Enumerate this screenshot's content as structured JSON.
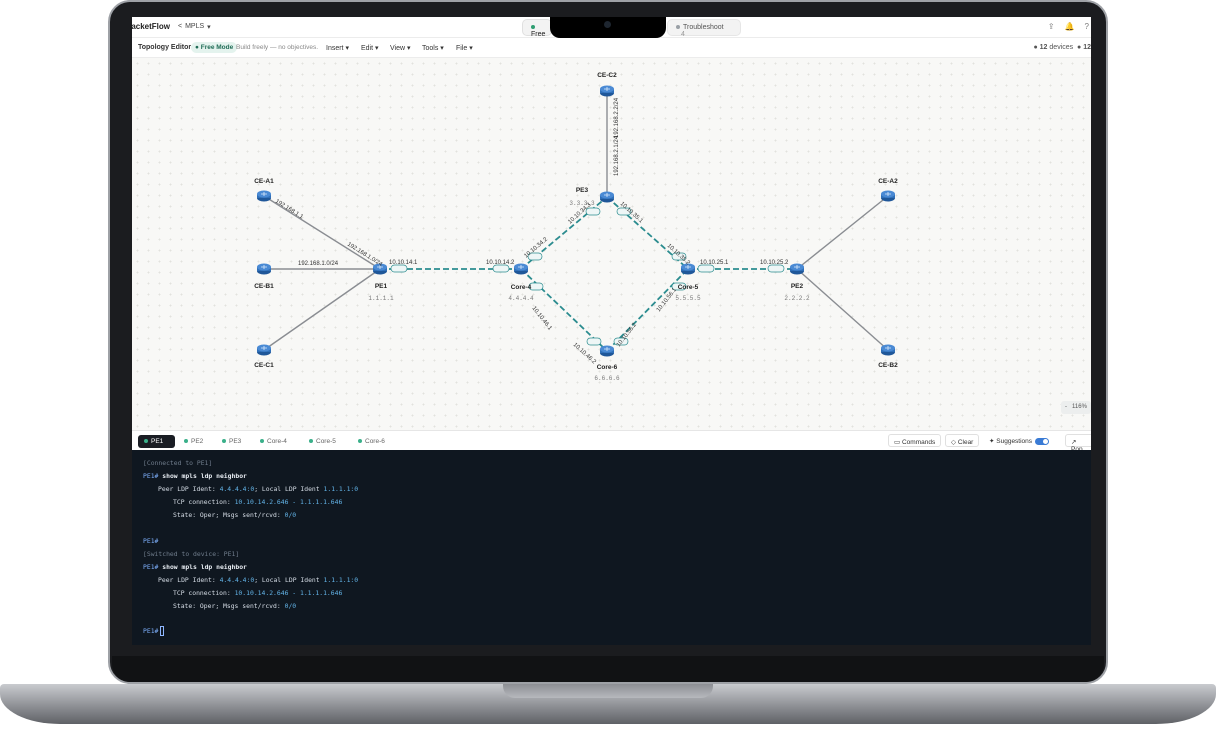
{
  "app": {
    "brand": "PacketFlow",
    "project": "MPLS"
  },
  "tabs": [
    {
      "label": "Free",
      "status_color": "#2f9e72"
    },
    {
      "label": "Troubleshoot",
      "count": "4"
    }
  ],
  "editor": {
    "title": "Topology Editor",
    "mode_badge": "Free Mode",
    "subtitle": "Build freely — no objectives.",
    "menus": [
      "Insert",
      "Edit",
      "View",
      "Tools",
      "File"
    ],
    "device_count": "12",
    "device_count_label": "devices",
    "extra_count": "12"
  },
  "topology": {
    "nodes": [
      {
        "id": "CE-C2",
        "loopback": ""
      },
      {
        "id": "PE3",
        "loopback": "3.3.3.3"
      },
      {
        "id": "CE-A1",
        "loopback": ""
      },
      {
        "id": "CE-B1",
        "loopback": ""
      },
      {
        "id": "CE-C1",
        "loopback": ""
      },
      {
        "id": "PE1",
        "loopback": "1.1.1.1"
      },
      {
        "id": "Core-4",
        "loopback": "4.4.4.4"
      },
      {
        "id": "Core-5",
        "loopback": "5.5.5.5"
      },
      {
        "id": "Core-6",
        "loopback": "6.6.6.6"
      },
      {
        "id": "PE2",
        "loopback": "2.2.2.2"
      },
      {
        "id": "CE-A2",
        "loopback": ""
      },
      {
        "id": "CE-B2",
        "loopback": ""
      }
    ],
    "link_labels": {
      "pe3_cec2": "192.168.2.1/24",
      "cec2_pe3": "192.168.2.2/24",
      "pe3_core4": "10.10.34.3",
      "core4_pe3": "10.10.34.2",
      "pe3_core5": "10.10.35.1",
      "core5_pe3": "10.10.35.2",
      "pe1_core4": "10.10.14.1",
      "core4_pe1": "10.10.14.2",
      "core5_pe2": "10.10.25.1",
      "pe2_core5": "10.10.25.2",
      "core4_core6": "10.10.46.1",
      "core6_core4": "10.10.46.2",
      "core5_core6": "10.10.56.1",
      "core6_core5": "10.10.56.2",
      "cea1_pe1": "192.168.1.1",
      "pe1_cea1": "192.168.1.0/24",
      "ceb1_pe1": "192.168.1.0/24"
    }
  },
  "zoom": {
    "minus": "-",
    "level": "116%"
  },
  "terminal_tabs": [
    {
      "label": "PE1",
      "active": true
    },
    {
      "label": "PE2"
    },
    {
      "label": "PE3"
    },
    {
      "label": "Core-4"
    },
    {
      "label": "Core-5"
    },
    {
      "label": "Core-6"
    }
  ],
  "terminal_actions": {
    "commands": "Commands",
    "clear": "Clear",
    "suggestions": "Suggestions",
    "popout": "Pop"
  },
  "terminal": {
    "connected": "[Connected to PE1]",
    "prompt": "PE1#",
    "command": "show mpls ldp neighbor",
    "peer_label": "Peer LDP Ident:",
    "peer_ident": "4.4.4.4:0",
    "local_label": "; Local LDP Ident",
    "local_ident": "1.1.1.1:0",
    "tcp_label": "TCP connection:",
    "tcp_value": "10.10.14.2.646 - 1.1.1.1.646",
    "state_label": "State: Oper; Msgs sent/rcvd:",
    "state_value": "0/0",
    "switched": "[Switched to device: PE1]"
  },
  "colors": {
    "link_active": "#2b8c8f",
    "link_idle": "#8a8d92",
    "router": "#2f6fb8",
    "accent": "#2f9e72"
  }
}
